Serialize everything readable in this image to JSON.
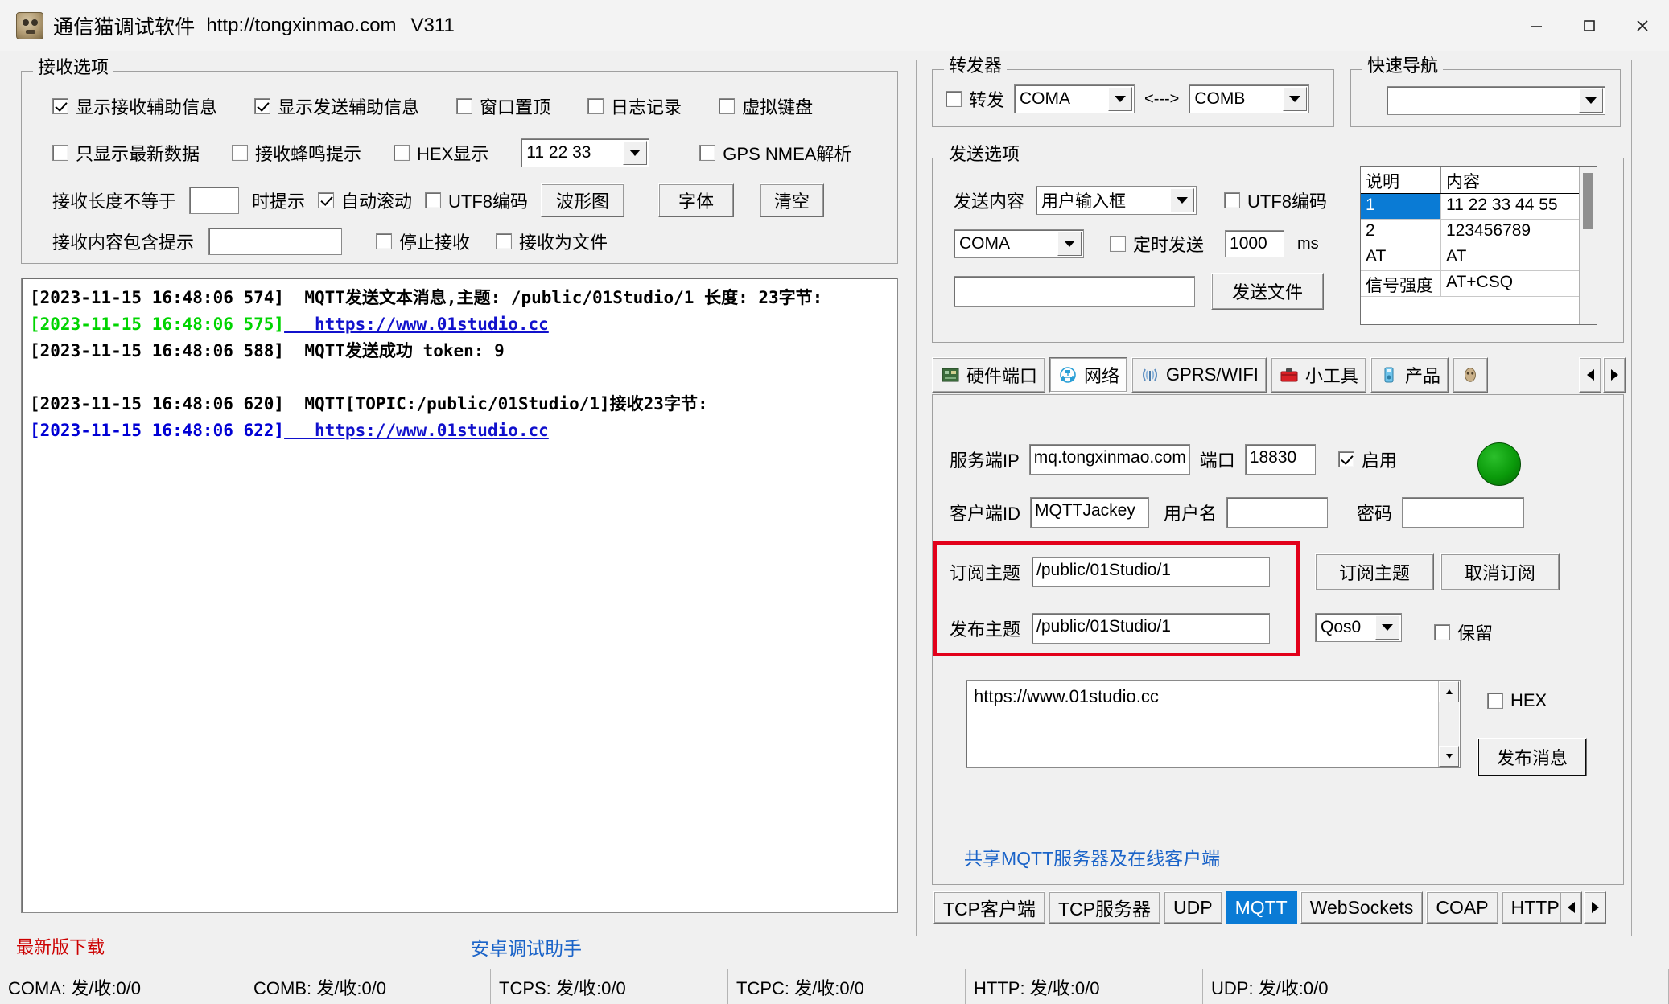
{
  "window": {
    "title": "通信猫调试软件",
    "url": "http://tongxinmao.com",
    "version": "V311",
    "minimize": "—",
    "maximize": "▢",
    "close": "✕"
  },
  "receive_options": {
    "legend": "接收选项",
    "row1": [
      {
        "label": "显示接收辅助信息",
        "checked": true
      },
      {
        "label": "显示发送辅助信息",
        "checked": true
      },
      {
        "label": "窗口置顶",
        "checked": false
      },
      {
        "label": "日志记录",
        "checked": false
      },
      {
        "label": "虚拟键盘",
        "checked": false
      }
    ],
    "row2": [
      {
        "label": "只显示最新数据",
        "checked": false
      },
      {
        "label": "接收蜂鸣提示",
        "checked": false
      },
      {
        "label": "HEX显示",
        "checked": false
      },
      {
        "label": "GPS NMEA解析",
        "checked": false
      }
    ],
    "hex_combo_value": "11 22 33",
    "row3": {
      "len_label": "接收长度不等于",
      "len_value": "",
      "len_suffix": "时提示",
      "autoscroll": {
        "label": "自动滚动",
        "checked": true
      },
      "utf8": {
        "label": "UTF8编码",
        "checked": false
      },
      "wave_button": "波形图",
      "font_button": "字体",
      "clear_button": "清空"
    },
    "row4": {
      "contains_label": "接收内容包含提示",
      "contains_value": "",
      "stop": {
        "label": "停止接收",
        "checked": false
      },
      "tofile": {
        "label": "接收为文件",
        "checked": false
      }
    }
  },
  "log_lines": [
    {
      "time": "[2023-11-15 16:48:06 574]",
      "time_color": "black",
      "text": "  MQTT发送文本消息,主题: /public/01Studio/1 长度: 23字节:",
      "text_color": "black",
      "link": false
    },
    {
      "time": "[2023-11-15 16:48:06 575]",
      "time_color": "green",
      "text": "   https://www.01studio.cc",
      "text_color": "link",
      "link": true
    },
    {
      "time": "[2023-11-15 16:48:06 588]",
      "time_color": "black",
      "text": "  MQTT发送成功 token: 9",
      "text_color": "black",
      "link": false
    },
    {
      "time": "",
      "time_color": "black",
      "text": "",
      "text_color": "black",
      "link": false
    },
    {
      "time": "[2023-11-15 16:48:06 620]",
      "time_color": "black",
      "text": "  MQTT[TOPIC:/public/01Studio/1]接收23字节:",
      "text_color": "black",
      "link": false
    },
    {
      "time": "[2023-11-15 16:48:06 622]",
      "time_color": "blue",
      "text": "   https://www.01studio.cc",
      "text_color": "link",
      "link": true
    }
  ],
  "footer_links": {
    "download": "最新版下载",
    "android": "安卓调试助手"
  },
  "forwarder": {
    "legend": "转发器",
    "enable": {
      "label": "转发",
      "checked": false
    },
    "port_a": "COMA",
    "arrow": "<--->",
    "port_b": "COMB"
  },
  "quick_nav": {
    "legend": "快速导航",
    "value": ""
  },
  "send_options": {
    "legend": "发送选项",
    "content_label": "发送内容",
    "content_value": "用户输入框",
    "utf8": {
      "label": "UTF8编码",
      "checked": false
    },
    "port_value": "COMA",
    "timer": {
      "label": "定时发送",
      "checked": false
    },
    "interval_value": "1000",
    "interval_unit": "ms",
    "file_path": "",
    "send_file_button": "发送文件"
  },
  "send_table": {
    "headers": [
      "说明",
      "内容"
    ],
    "rows": [
      {
        "desc": "1",
        "content": "11 22 33 44 55",
        "selected": true
      },
      {
        "desc": "2",
        "content": "123456789",
        "selected": false
      },
      {
        "desc": "AT",
        "content": "AT",
        "selected": false
      },
      {
        "desc": "信号强度",
        "content": "AT+CSQ",
        "selected": false
      }
    ]
  },
  "main_tabs": [
    {
      "label": "硬件端口",
      "icon": "chip-icon",
      "active": false
    },
    {
      "label": "网络",
      "icon": "network-icon",
      "active": true
    },
    {
      "label": "GPRS/WIFI",
      "icon": "antenna-icon",
      "active": false
    },
    {
      "label": "小工具",
      "icon": "toolbox-icon",
      "active": false
    },
    {
      "label": "产品",
      "icon": "product-icon",
      "active": false
    }
  ],
  "mqtt": {
    "server_ip_label": "服务端IP",
    "server_ip_value": "mq.tongxinmao.com",
    "port_label": "端口",
    "port_value": "18830",
    "enable": {
      "label": "启用",
      "checked": true
    },
    "status_led_color": "#0a9a0a",
    "client_id_label": "客户端ID",
    "client_id_value": "MQTTJackey",
    "username_label": "用户名",
    "username_value": "",
    "password_label": "密码",
    "password_value": "",
    "sub_topic_label": "订阅主题",
    "sub_topic_value": "/public/01Studio/1",
    "pub_topic_label": "发布主题",
    "pub_topic_value": "/public/01Studio/1",
    "subscribe_button": "订阅主题",
    "unsubscribe_button": "取消订阅",
    "qos_value": "Qos0",
    "retain": {
      "label": "保留",
      "checked": false
    },
    "message_value": "https://www.01studio.cc",
    "hex": {
      "label": "HEX",
      "checked": false
    },
    "publish_button": "发布消息",
    "share_link": "共享MQTT服务器及在线客户端",
    "highlight_color": "#e2001a"
  },
  "protocol_tabs": [
    {
      "label": "TCP客户端",
      "active": false
    },
    {
      "label": "TCP服务器",
      "active": false
    },
    {
      "label": "UDP",
      "active": false
    },
    {
      "label": "MQTT",
      "active": true
    },
    {
      "label": "WebSockets",
      "active": false
    },
    {
      "label": "COAP",
      "active": false
    },
    {
      "label": "HTTP",
      "active": false
    }
  ],
  "status_bar": [
    "COMA: 发/收:0/0",
    "COMB: 发/收:0/0",
    "TCPS: 发/收:0/0",
    "TCPC: 发/收:0/0",
    "HTTP: 发/收:0/0",
    "UDP: 发/收:0/0",
    ""
  ]
}
